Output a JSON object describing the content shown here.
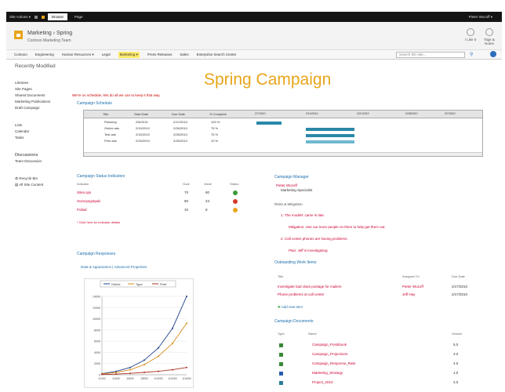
{
  "topbar": {
    "site_actions": "Site Actions ▾",
    "tabs": [
      "Browse",
      "Page"
    ],
    "user": "Pieter Wuzoff ▾"
  },
  "header": {
    "breadcrumb": "Marketing › Spring",
    "site_name": "Contoso Marketing Team",
    "btn_like": "I Like It",
    "btn_tags": "Tags & Notes"
  },
  "nav": {
    "items": [
      "Contoso",
      "Engineering",
      "Human Resources ▾",
      "Legal",
      "Marketing ▾",
      "Press Releases",
      "Sales",
      "Enterprise Search Center"
    ],
    "selected": 4,
    "search_placeholder": "Search this site..."
  },
  "left": {
    "recent": "Recently Modified",
    "items": [
      "Libraries",
      "Site Pages",
      "Shared Documents",
      "Marketing Publications",
      "Draft Campaign"
    ],
    "items2": [
      "Lists",
      "Calendar",
      "Tasks"
    ],
    "disc": "Discussions",
    "disc_item": "Team Discussion",
    "recycle": "Recycle Bin",
    "all": "All Site Content"
  },
  "main": {
    "title": "Spring Campaign",
    "note": "We're on schedule, lets do all we can to keep it that way.",
    "schedule": {
      "title": "Campaign Schedule",
      "headers": [
        "Title",
        "Start Date",
        "Due Date",
        "% Complete"
      ],
      "rows": [
        [
          "Planning",
          "2/8/2010",
          "2/12/2010",
          "100 %"
        ],
        [
          "Online ads",
          "2/15/2010",
          "2/26/2010",
          "75 %"
        ],
        [
          "Test ads",
          "2/15/2010",
          "2/26/2010",
          "75 %"
        ],
        [
          "Print ads",
          "2/15/2010",
          "2/26/2010",
          "10 %"
        ]
      ],
      "weeks": [
        "2/7/2010",
        "2/14/2010",
        "2/21/2010",
        "2/28/2010",
        "3/7/2010"
      ],
      "days": "S M T W T F S"
    },
    "status": {
      "title": "Campaign Status Indicators",
      "headers": [
        "Indicator",
        "Goal",
        "Value",
        "Status"
      ],
      "rows": [
        {
          "n": "Sites.sps",
          "g": "70",
          "v": "80",
          "c": "#3a9a3a"
        },
        {
          "n": "Surveysgotpab",
          "g": "90",
          "v": "23",
          "c": "#d23a2a"
        },
        {
          "n": "Pollad",
          "g": "10",
          "v": "8",
          "c": "#e8a51a"
        }
      ],
      "link": "* Click here for indicator details"
    },
    "responses": {
      "title": "Campaign Responses",
      "links": "Data & Appearance | Advanced Properties"
    },
    "manager": {
      "title": "Campaign Manager",
      "name": "Pieter Wuzoff",
      "role": "Marketing Specialist"
    },
    "risks": {
      "title": "Risks & Mitigation",
      "items": [
        "1. The models' came in late.",
        "Mitigation: Use our more people on them to help get them out.",
        "2. Call center phones are having problems.",
        "Plan: Jeff is investigating."
      ]
    },
    "work": {
      "title": "Outstanding Work Items",
      "headers": [
        "Title",
        "Assigned To",
        "Due Date"
      ],
      "rows": [
        [
          "Investigate bad class postage for mailers",
          "Pieter Wuzoff",
          "2/17/2010"
        ],
        [
          "Phone problems at call center",
          "Jeff Hay",
          "2/17/2010"
        ]
      ],
      "add": "Add new item"
    },
    "docs": {
      "title": "Campaign Documents",
      "headers": [
        "Type",
        "Name",
        "Version"
      ],
      "rows": [
        [
          "Campaign_Postsbook",
          "5.0"
        ],
        [
          "Campaign_Projections",
          "3.0"
        ],
        [
          "Campaign_Response_Rate",
          "4.0"
        ],
        [
          "Marketing_Strategy",
          "1.0"
        ],
        [
          "Project_2010",
          "3.0"
        ]
      ]
    }
  },
  "chart_data": {
    "type": "line",
    "x": [
      "1/1/02",
      "1/4/02",
      "1/6/02",
      "1/8/02",
      "1/10/02",
      "1/12/02",
      "1/14/02"
    ],
    "series": [
      {
        "name": "Online",
        "values": [
          200,
          600,
          1300,
          2600,
          4800,
          8300,
          14000
        ]
      },
      {
        "name": "Type",
        "values": [
          150,
          400,
          900,
          1800,
          3300,
          5600,
          9200
        ]
      },
      {
        "name": "Print",
        "values": [
          50,
          120,
          250,
          420,
          620,
          900,
          1300
        ]
      }
    ],
    "ylim": [
      0,
      14000
    ],
    "yticks": [
      "14000",
      "12000",
      "10000",
      "8000",
      "6000",
      "4000",
      "2000",
      "0"
    ],
    "colors": [
      "#1c3f8a",
      "#d88a1a",
      "#a83222"
    ]
  }
}
